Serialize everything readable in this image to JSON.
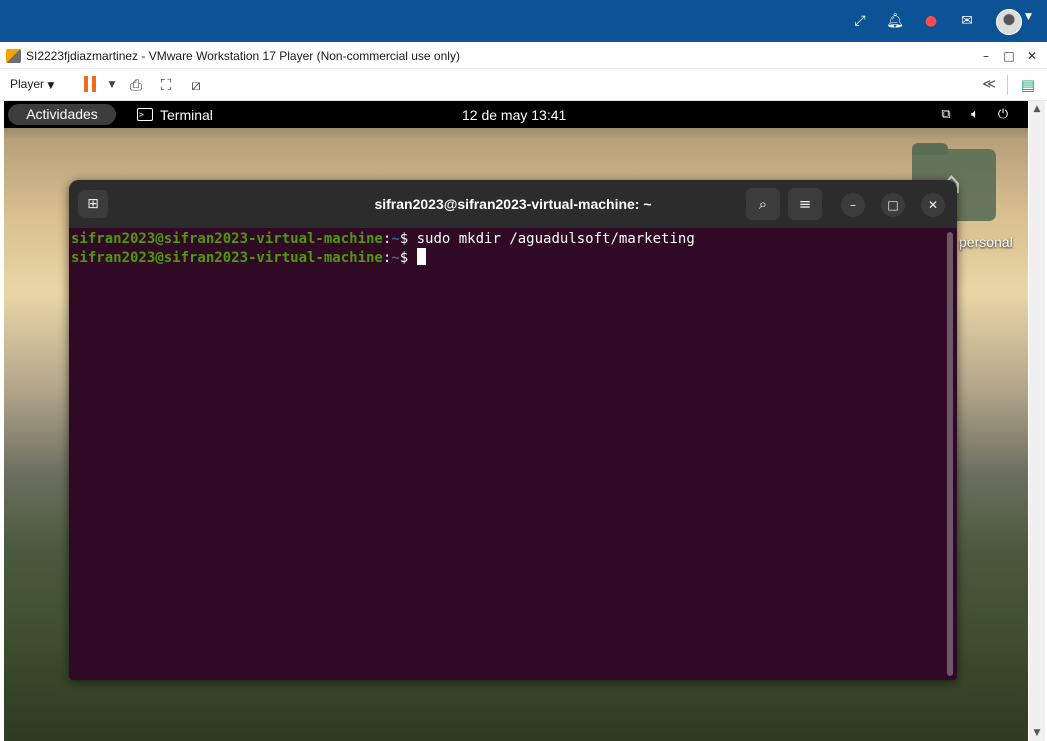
{
  "topbar": {
    "icons": [
      "expand-icon",
      "bell-icon",
      "chat-icon",
      "mail-icon"
    ],
    "accent": "#0b5394"
  },
  "vmware": {
    "title": "SI2223fjdiazmartinez - VMware Workstation 17 Player (Non-commercial use only)",
    "player_menu": "Player",
    "controls": {
      "minimize": "–",
      "maximize": "□",
      "close": "✕"
    }
  },
  "gnome": {
    "activities": "Actividades",
    "app_name": "Terminal",
    "clock": "12 de may  13:41"
  },
  "desktop": {
    "home_label": "personal"
  },
  "terminal": {
    "title": "sifran2023@sifran2023-virtual-machine: ~",
    "lines": [
      {
        "user": "sifran2023@sifran2023-virtual-machine",
        "sep": ":",
        "path": "~",
        "symbol": "$ ",
        "command": "sudo mkdir /aguadulsoft/marketing"
      },
      {
        "user": "sifran2023@sifran2023-virtual-machine",
        "sep": ":",
        "path": "~",
        "symbol": "$ ",
        "command": ""
      }
    ],
    "colors": {
      "background": "#300a24",
      "user": "#4e9a06",
      "path": "#3465a4"
    }
  }
}
